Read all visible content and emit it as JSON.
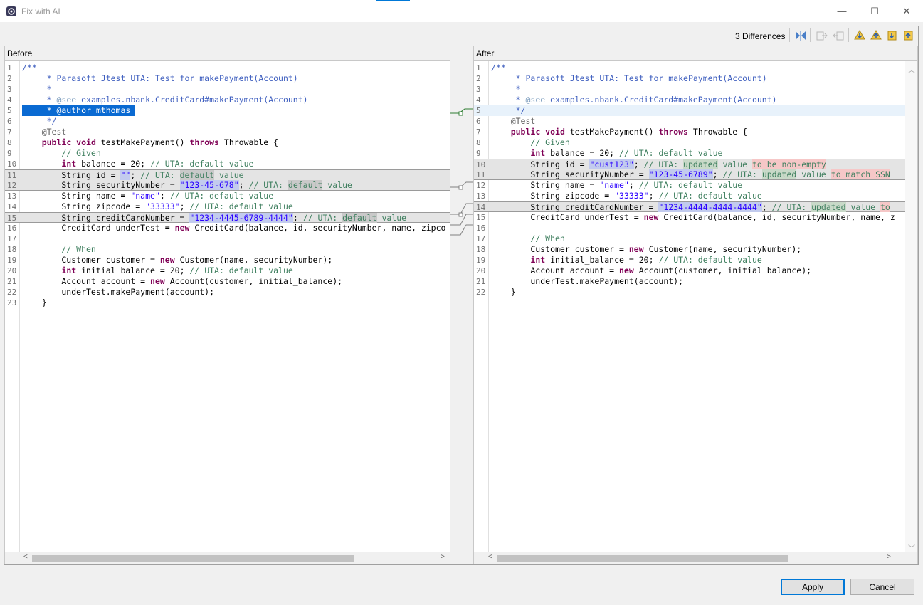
{
  "window": {
    "title": "Fix with AI",
    "minimize_glyph": "—",
    "maximize_glyph": "☐",
    "close_glyph": "✕"
  },
  "toolbar": {
    "diff_count": "3 Differences",
    "icons": [
      "copy-all-icon",
      "copy-left-to-right-icon",
      "copy-right-to-left-icon",
      "next-difference-icon",
      "previous-difference-icon",
      "next-change-icon",
      "previous-change-icon"
    ]
  },
  "left": {
    "header": "Before",
    "lines": [
      {
        "n": "1",
        "html": "<span class=\"doc\">/**</span>"
      },
      {
        "n": "2",
        "html": "<span class=\"doc\">     * Parasoft Jtest UTA: Test for makePayment(Account)</span>"
      },
      {
        "n": "3",
        "html": "<span class=\"doc\">     *</span>"
      },
      {
        "n": "4",
        "html": "<span class=\"doc\">     * <span class=\"tag\">@see</span> examples.nbank.CreditCard#makePayment(Account)</span>"
      },
      {
        "n": "5",
        "html": "     * @author mthomas ",
        "cls": "selected"
      },
      {
        "n": "6",
        "html": "<span class=\"doc\">     */</span>"
      },
      {
        "n": "7",
        "html": "    <span class=\"ann\">@Test</span>"
      },
      {
        "n": "8",
        "html": "    <span class=\"kw\">public void</span> testMakePayment() <span class=\"kw\">throws</span> Throwable {"
      },
      {
        "n": "9",
        "html": "        <span class=\"cmt\">// Given</span>"
      },
      {
        "n": "10",
        "html": "        <span class=\"kw\">int</span> balance = 20; <span class=\"cmt\">// UTA: default value</span>"
      },
      {
        "n": "11",
        "html": "        String id = <span class=\"str hl-str\">\"\"</span>; <span class=\"cmt\">// UTA: <span class=\"hl-def\">default</span> value</span>",
        "cls": "changed changed-top"
      },
      {
        "n": "12",
        "html": "        String securityNumber = <span class=\"str hl-str\">\"123-45-678\"</span>; <span class=\"cmt\">// UTA: <span class=\"hl-def\">default</span> value</span>",
        "cls": "changed changed-bot"
      },
      {
        "n": "13",
        "html": "        String name = <span class=\"str\">\"name\"</span>; <span class=\"cmt\">// UTA: default value</span>"
      },
      {
        "n": "14",
        "html": "        String zipcode = <span class=\"str\">\"33333\"</span>; <span class=\"cmt\">// UTA: default value</span>"
      },
      {
        "n": "15",
        "html": "        String creditCardNumber = <span class=\"str hl-str\">\"1234-4445-6789-4444\"</span>; <span class=\"cmt\">// UTA: <span class=\"hl-def\">default</span> value</span>",
        "cls": "changed changed-top changed-bot"
      },
      {
        "n": "16",
        "html": "        CreditCard underTest = <span class=\"kw\">new</span> CreditCard(balance, id, securityNumber, name, zipco"
      },
      {
        "n": "17",
        "html": ""
      },
      {
        "n": "18",
        "html": "        <span class=\"cmt\">// When</span>"
      },
      {
        "n": "19",
        "html": "        Customer customer = <span class=\"kw\">new</span> Customer(name, securityNumber);"
      },
      {
        "n": "20",
        "html": "        <span class=\"kw\">int</span> initial_balance = 20; <span class=\"cmt\">// UTA: default value</span>"
      },
      {
        "n": "21",
        "html": "        Account account = <span class=\"kw\">new</span> Account(customer, initial_balance);"
      },
      {
        "n": "22",
        "html": "        underTest.makePayment(account);"
      },
      {
        "n": "23",
        "html": "    }"
      }
    ]
  },
  "right": {
    "header": "After",
    "lines": [
      {
        "n": "1",
        "html": "<span class=\"doc\">/**</span>"
      },
      {
        "n": "2",
        "html": "<span class=\"doc\">     * Parasoft Jtest UTA: Test for makePayment(Account)</span>"
      },
      {
        "n": "3",
        "html": "<span class=\"doc\">     *</span>"
      },
      {
        "n": "4",
        "html": "<span class=\"doc\">     * <span class=\"tag\">@see</span> examples.nbank.CreditCard#makePayment(Account)</span>",
        "cls": "insert-marker"
      },
      {
        "n": "5",
        "html": "<span class=\"doc\">     */</span>",
        "cls": "faint"
      },
      {
        "n": "6",
        "html": "    <span class=\"ann\">@Test</span>"
      },
      {
        "n": "7",
        "html": "    <span class=\"kw\">public void</span> testMakePayment() <span class=\"kw\">throws</span> Throwable {"
      },
      {
        "n": "8",
        "html": "        <span class=\"cmt\">// Given</span>"
      },
      {
        "n": "9",
        "html": "        <span class=\"kw\">int</span> balance = 20; <span class=\"cmt\">// UTA: default value</span>"
      },
      {
        "n": "10",
        "html": "        String id = <span class=\"str hl-str\">\"cust123\"</span>; <span class=\"cmt\">// UTA: <span class=\"hl-add\">updated</span> value <span class=\"hl-chg\">to be non-empty</span></span>",
        "cls": "changed changed-top"
      },
      {
        "n": "11",
        "html": "        String securityNumber = <span class=\"str hl-str\">\"123-45-6789\"</span>; <span class=\"cmt\">// UTA: <span class=\"hl-add\">updated</span> value <span class=\"hl-chg\">to match SSN</span></span>",
        "cls": "changed changed-bot"
      },
      {
        "n": "12",
        "html": "        String name = <span class=\"str\">\"name\"</span>; <span class=\"cmt\">// UTA: default value</span>"
      },
      {
        "n": "13",
        "html": "        String zipcode = <span class=\"str\">\"33333\"</span>; <span class=\"cmt\">// UTA: default value</span>"
      },
      {
        "n": "14",
        "html": "        String creditCardNumber = <span class=\"str hl-str\">\"1234-4444-4444-4444\"</span>; <span class=\"cmt\">// UTA: <span class=\"hl-add\">updated</span> value <span class=\"hl-chg\">to</span></span>",
        "cls": "changed changed-top changed-bot"
      },
      {
        "n": "15",
        "html": "        CreditCard underTest = <span class=\"kw\">new</span> CreditCard(balance, id, securityNumber, name, z"
      },
      {
        "n": "16",
        "html": ""
      },
      {
        "n": "17",
        "html": "        <span class=\"cmt\">// When</span>"
      },
      {
        "n": "18",
        "html": "        Customer customer = <span class=\"kw\">new</span> Customer(name, securityNumber);"
      },
      {
        "n": "19",
        "html": "        <span class=\"kw\">int</span> initial_balance = 20; <span class=\"cmt\">// UTA: default value</span>"
      },
      {
        "n": "20",
        "html": "        Account account = <span class=\"kw\">new</span> Account(customer, initial_balance);"
      },
      {
        "n": "21",
        "html": "        underTest.makePayment(account);"
      },
      {
        "n": "22",
        "html": "    }"
      }
    ]
  },
  "buttons": {
    "apply": "Apply",
    "cancel": "Cancel"
  }
}
